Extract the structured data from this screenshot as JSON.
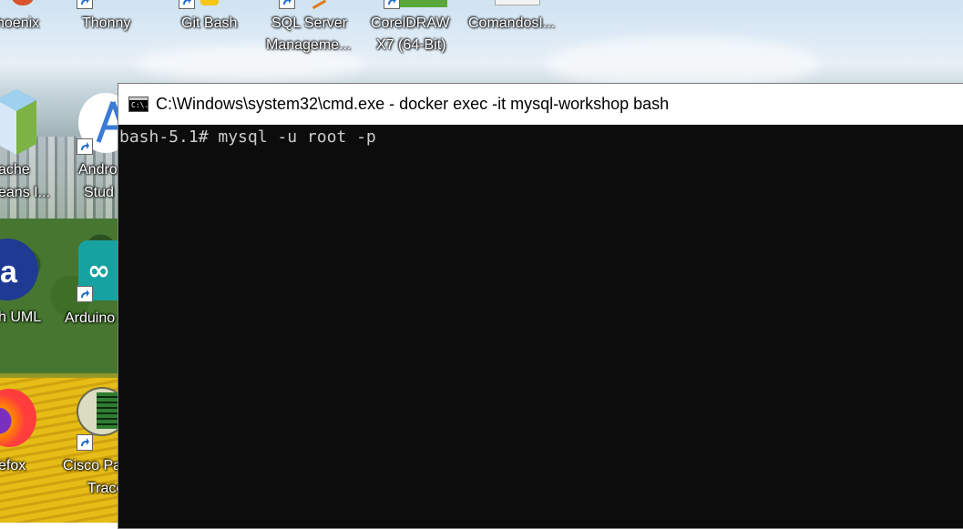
{
  "desktop": {
    "icons": [
      {
        "label": "hoenix"
      },
      {
        "label": "Thonny"
      },
      {
        "label": "Git Bash"
      },
      {
        "label_line1": "SQL Server",
        "label_line2": "Manageme..."
      },
      {
        "label_line1": "CorelDRAW",
        "label_line2": "X7 (64-Bit)"
      },
      {
        "label": "ComandosI..."
      },
      {
        "label_line1": "ache",
        "label_line2": "eans I..."
      },
      {
        "label_line1": "Andro",
        "label_line2": "Stud"
      },
      {
        "label": "h UML"
      },
      {
        "label": "Arduino"
      },
      {
        "label": "efox"
      },
      {
        "label_line1": "Cisco Pa",
        "label_line2": "Trace"
      }
    ]
  },
  "window": {
    "title": "C:\\Windows\\system32\\cmd.exe - docker  exec -it mysql-workshop bash",
    "icon_text": "C:\\.",
    "console_line": "bash-5.1# mysql -u root -p"
  },
  "colors": {
    "console_bg": "#0c0c0c",
    "console_fg": "#cccccc",
    "titlebar_bg": "#ffffff"
  }
}
